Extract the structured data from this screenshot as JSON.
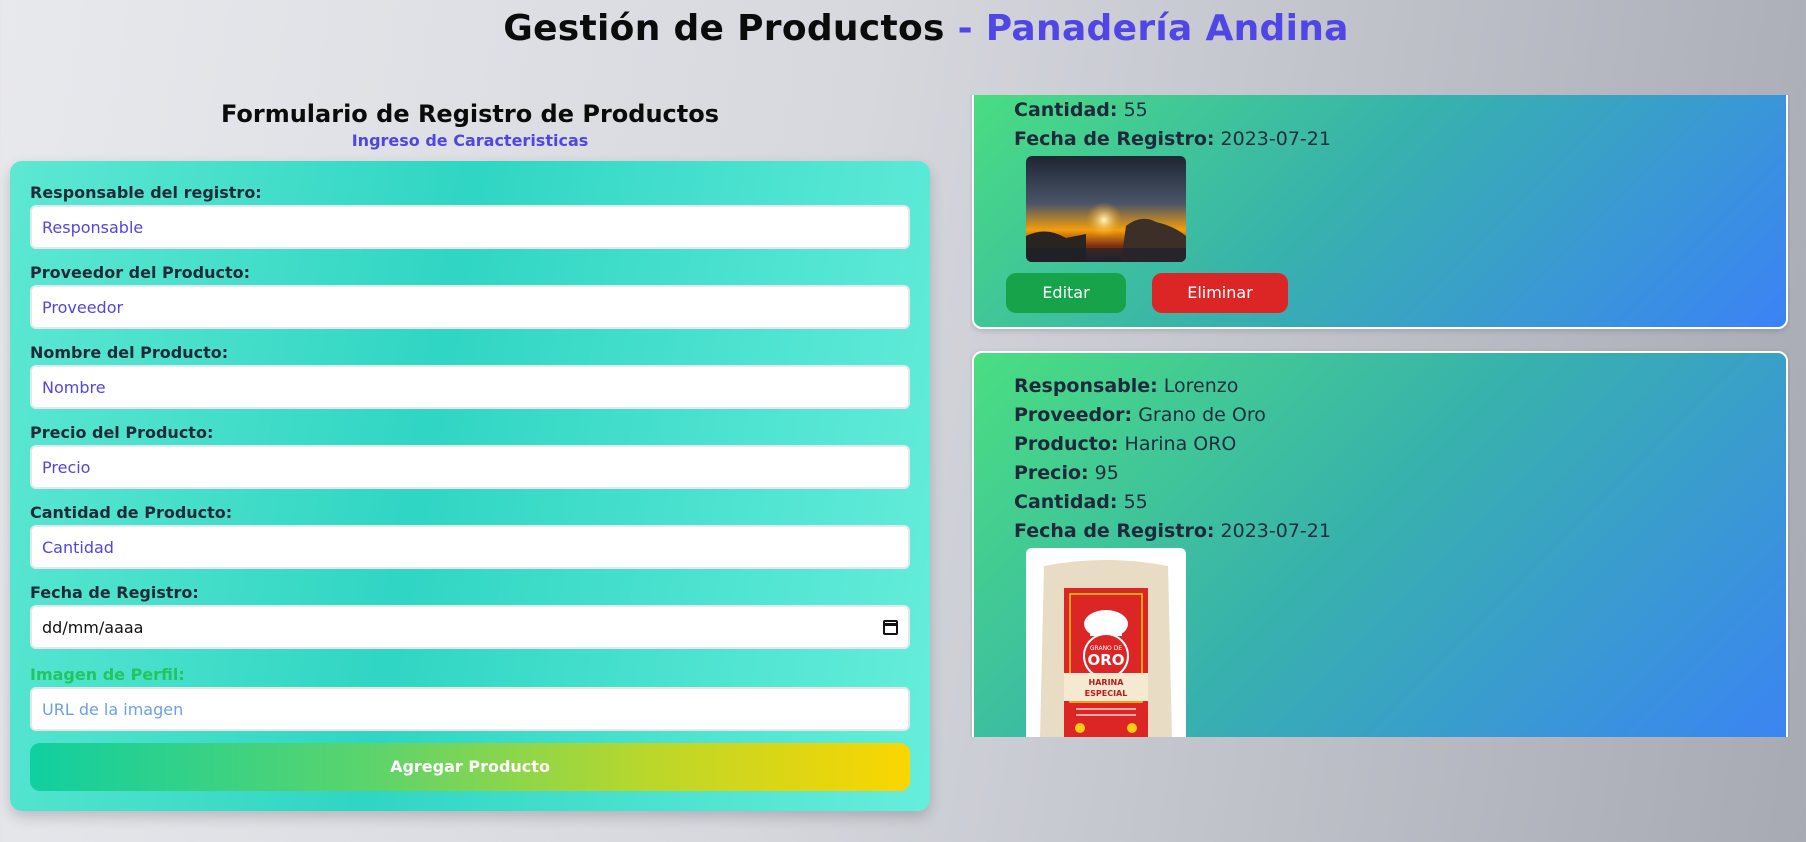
{
  "header": {
    "title_main": "Gestión de Productos",
    "title_accent": "- Panadería Andina"
  },
  "form": {
    "heading": "Formulario de Registro de Productos",
    "subheading": "Ingreso de Caracteristicas",
    "fields": [
      {
        "label": "Responsable del registro:",
        "placeholder": "Responsable"
      },
      {
        "label": "Proveedor del Producto:",
        "placeholder": "Proveedor"
      },
      {
        "label": "Nombre del Producto:",
        "placeholder": "Nombre"
      },
      {
        "label": "Precio del Producto:",
        "placeholder": "Precio"
      },
      {
        "label": "Cantidad de Producto:",
        "placeholder": "Cantidad"
      },
      {
        "label": "Fecha de Registro:",
        "placeholder": "dd/mm/aaaa"
      },
      {
        "label": "Imagen de Perfil:",
        "placeholder": "URL de la imagen"
      }
    ],
    "submit_label": "Agregar Producto"
  },
  "products": [
    {
      "labels": {
        "cantidad": "Cantidad:",
        "fecha": "Fecha de Registro:"
      },
      "cantidad": "55",
      "fecha": "2023-07-21",
      "image": "sunset-photo",
      "edit_label": "Editar",
      "delete_label": "Eliminar"
    },
    {
      "labels": {
        "responsable": "Responsable:",
        "proveedor": "Proveedor:",
        "producto": "Producto:",
        "precio": "Precio:",
        "cantidad": "Cantidad:",
        "fecha": "Fecha de Registro:"
      },
      "responsable": "Lorenzo",
      "proveedor": "Grano de Oro",
      "producto": "Harina ORO",
      "precio": "95",
      "cantidad": "55",
      "fecha": "2023-07-21",
      "image": "flour-bag-photo",
      "bag_brand_line1": "GRANO DE",
      "bag_brand_line2": "ORO",
      "bag_product_line1": "HARINA",
      "bag_product_line2": "ESPECIAL"
    }
  ],
  "colors": {
    "accent": "#4f46e5",
    "edit": "#16a34a",
    "delete": "#dc2626"
  }
}
